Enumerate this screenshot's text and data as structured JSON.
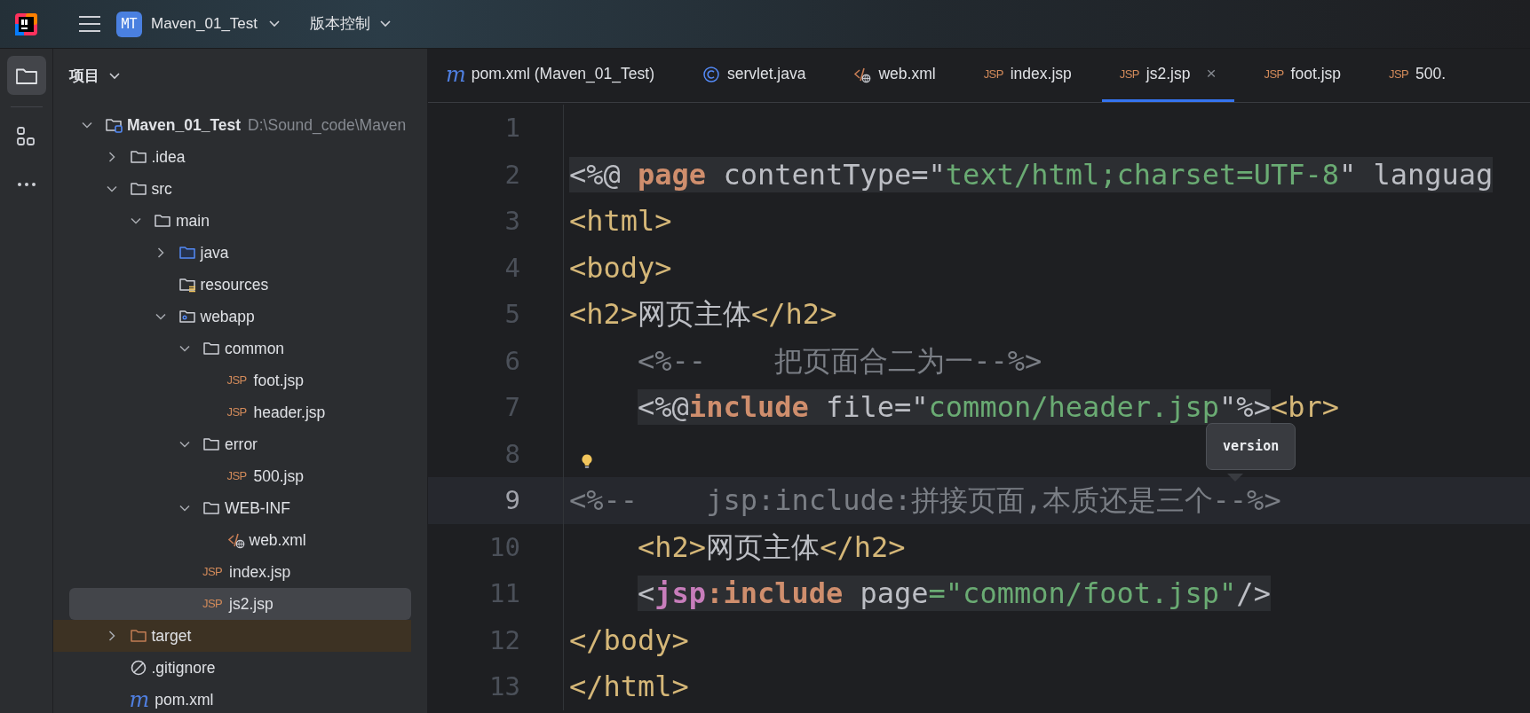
{
  "title_bar": {
    "project_badge": "MT",
    "project": "Maven_01_Test",
    "vcs": "版本控制"
  },
  "tool_strip": [
    {
      "kind": "project",
      "selected": true
    },
    {
      "kind": "structure",
      "selected": false
    },
    {
      "kind": "more",
      "selected": false
    }
  ],
  "project_panel": {
    "title": "项目",
    "tree": [
      {
        "label": "Maven_01_Test",
        "path": "D:\\Sound_code\\Maven",
        "kind": "module",
        "expanded": true,
        "selected": false,
        "children": [
          {
            "label": ".idea",
            "kind": "folder",
            "expanded": false,
            "selected": false
          },
          {
            "label": "src",
            "kind": "folder",
            "expanded": true,
            "selected": false,
            "children": [
              {
                "label": "main",
                "kind": "folder",
                "expanded": true,
                "selected": false,
                "children": [
                  {
                    "label": "java",
                    "kind": "source",
                    "expanded": false,
                    "selected": false
                  },
                  {
                    "label": "resources",
                    "kind": "resources",
                    "selected": false
                  },
                  {
                    "label": "webapp",
                    "kind": "web",
                    "expanded": true,
                    "selected": false,
                    "children": [
                      {
                        "label": "common",
                        "kind": "folder",
                        "expanded": true,
                        "selected": false,
                        "children": [
                          {
                            "label": "foot.jsp",
                            "kind": "jsp",
                            "badge": "JSP",
                            "selected": false
                          },
                          {
                            "label": "header.jsp",
                            "kind": "jsp",
                            "badge": "JSP",
                            "selected": false
                          }
                        ]
                      },
                      {
                        "label": "error",
                        "kind": "folder",
                        "expanded": true,
                        "selected": false,
                        "children": [
                          {
                            "label": "500.jsp",
                            "kind": "jsp",
                            "badge": "JSP",
                            "selected": false
                          }
                        ]
                      },
                      {
                        "label": "WEB-INF",
                        "kind": "folder",
                        "expanded": true,
                        "selected": false,
                        "children": [
                          {
                            "label": "web.xml",
                            "kind": "xml",
                            "selected": false
                          }
                        ]
                      },
                      {
                        "label": "index.jsp",
                        "kind": "jsp",
                        "badge": "JSP",
                        "selected": false
                      },
                      {
                        "label": "js2.jsp",
                        "kind": "jsp",
                        "badge": "JSP",
                        "selected": true
                      }
                    ]
                  }
                ]
              }
            ]
          },
          {
            "label": "target",
            "kind": "excluded",
            "expanded": false,
            "selected": false
          },
          {
            "label": ".gitignore",
            "kind": "ignore",
            "selected": false
          },
          {
            "label": "pom.xml",
            "kind": "maven",
            "badge": "m",
            "selected": false
          }
        ]
      }
    ]
  },
  "editor": {
    "tabs": [
      {
        "label": "pom.xml (Maven_01_Test)",
        "kind": "maven",
        "badge": "m",
        "selected": false
      },
      {
        "label": "servlet.java",
        "kind": "class",
        "selected": false
      },
      {
        "label": "web.xml",
        "kind": "xml",
        "selected": false
      },
      {
        "label": "index.jsp",
        "kind": "jsp",
        "badge": "JSP",
        "selected": false
      },
      {
        "label": "js2.jsp",
        "kind": "jsp",
        "badge": "JSP",
        "selected": true,
        "close": "×"
      },
      {
        "label": "foot.jsp",
        "kind": "jsp",
        "badge": "JSP",
        "selected": false
      },
      {
        "label": "500.",
        "kind": "jsp",
        "badge": "JSP",
        "selected": false
      }
    ],
    "lines": [
      {
        "number": "1",
        "current": false
      },
      {
        "number": "2",
        "current": false,
        "indented": false,
        "groups": [
          {
            "highlighted": true,
            "tokens": [
              {
                "kind": "plain",
                "text": "<%@ "
              },
              {
                "kind": "keyword",
                "text": "page"
              },
              {
                "kind": "plain",
                "text": " contentType=\""
              },
              {
                "kind": "string",
                "text": "text/html;charset=UTF-8"
              },
              {
                "kind": "plain",
                "text": "\" languag"
              }
            ]
          }
        ]
      },
      {
        "number": "3",
        "current": false,
        "indented": false,
        "groups": [
          {
            "highlighted": false,
            "tokens": [
              {
                "kind": "tag",
                "text": "<html>"
              }
            ]
          }
        ]
      },
      {
        "number": "4",
        "current": false,
        "indented": false,
        "groups": [
          {
            "highlighted": false,
            "tokens": [
              {
                "kind": "tag",
                "text": "<body>"
              }
            ]
          }
        ]
      },
      {
        "number": "5",
        "current": false,
        "indented": false,
        "groups": [
          {
            "highlighted": false,
            "tokens": [
              {
                "kind": "tag",
                "text": "<h2>"
              },
              {
                "kind": "text",
                "text": "网页主体"
              },
              {
                "kind": "tag",
                "text": "</h2>"
              }
            ]
          }
        ]
      },
      {
        "number": "6",
        "current": false,
        "indented": true,
        "groups": [
          {
            "highlighted": false,
            "tokens": [
              {
                "kind": "comment",
                "text": "<%--    把页面合二为一--%>"
              }
            ]
          }
        ]
      },
      {
        "number": "7",
        "current": false,
        "indented": true,
        "groups": [
          {
            "highlighted": true,
            "tokens": [
              {
                "kind": "plain",
                "text": "<%@"
              },
              {
                "kind": "keyword",
                "text": "include"
              },
              {
                "kind": "plain",
                "text": " file=\""
              },
              {
                "kind": "string",
                "text": "common/header.jsp"
              },
              {
                "kind": "plain",
                "text": "\"%>"
              }
            ]
          },
          {
            "highlighted": false,
            "tokens": [
              {
                "kind": "tag",
                "text": "<br>"
              }
            ]
          }
        ]
      },
      {
        "number": "8",
        "current": false,
        "bulb": true
      },
      {
        "number": "9",
        "current": true,
        "indented": false,
        "groups": [
          {
            "highlighted": false,
            "tokens": [
              {
                "kind": "comment",
                "text": "<%--    jsp:include:拼接页面,本质还是三个--%>"
              }
            ]
          }
        ]
      },
      {
        "number": "10",
        "current": false,
        "indented": true,
        "groups": [
          {
            "highlighted": false,
            "tokens": [
              {
                "kind": "tag",
                "text": "<h2>"
              },
              {
                "kind": "text",
                "text": "网页主体"
              },
              {
                "kind": "tag",
                "text": "</h2>"
              }
            ]
          }
        ]
      },
      {
        "number": "11",
        "current": false,
        "indented": true,
        "groups": [
          {
            "highlighted": true,
            "tokens": [
              {
                "kind": "plain",
                "text": "<"
              },
              {
                "kind": "ns",
                "text": "jsp"
              },
              {
                "kind": "keyword",
                "text": ":include"
              },
              {
                "kind": "plain",
                "text": " page"
              },
              {
                "kind": "string",
                "text": "=\"common/foot.jsp\""
              },
              {
                "kind": "plain",
                "text": "/>"
              }
            ]
          }
        ]
      },
      {
        "number": "12",
        "current": false,
        "indented": false,
        "groups": [
          {
            "highlighted": false,
            "tokens": [
              {
                "kind": "tag",
                "text": "</body>"
              }
            ]
          }
        ]
      },
      {
        "number": "13",
        "current": false,
        "indented": false,
        "groups": [
          {
            "highlighted": false,
            "tokens": [
              {
                "kind": "tag",
                "text": "</html>"
              }
            ]
          }
        ]
      }
    ],
    "tooltip": "version"
  }
}
